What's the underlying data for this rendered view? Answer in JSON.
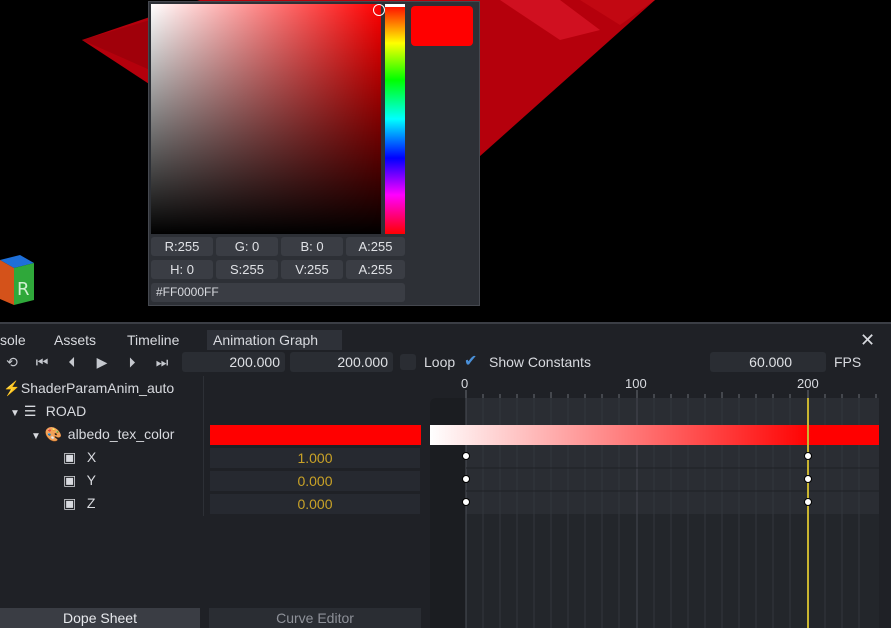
{
  "picker": {
    "color_hex": "#FF0000FF",
    "swatch_color": "#ff0000",
    "rgba": {
      "r": "R:255",
      "g": "G:  0",
      "b": "B:  0",
      "a": "A:255"
    },
    "hsva": {
      "h": "H:  0",
      "s": "S:255",
      "v": "V:255",
      "a": "A:255"
    }
  },
  "tabs": [
    {
      "label": "sole"
    },
    {
      "label": "Assets"
    },
    {
      "label": "Timeline"
    },
    {
      "label": "Animation Graph"
    }
  ],
  "toolbar": {
    "icons": [
      "reset-icon",
      "skip-start-icon",
      "prev-frame-icon",
      "play-icon",
      "next-frame-icon",
      "skip-end-icon"
    ],
    "start_value": "200.000",
    "end_value": "200.000",
    "loop_label": "Loop",
    "show_constants_label": "Show Constants",
    "fps_value": "60.000",
    "fps_label": "FPS"
  },
  "tree": {
    "animation": "ShaderParamAnim_auto",
    "node": "ROAD",
    "param": "albedo_tex_color",
    "channels": [
      {
        "name": "X",
        "value": "1.000"
      },
      {
        "name": "Y",
        "value": "0.000"
      },
      {
        "name": "Z",
        "value": "0.000"
      }
    ]
  },
  "ruler": {
    "ticks": [
      "0",
      "100",
      "200"
    ]
  },
  "bottom_tabs": {
    "dope_sheet": "Dope Sheet",
    "curve_editor": "Curve Editor"
  },
  "colors": {
    "accent": "#4a90d9",
    "playhead": "#c9b530",
    "value_text": "#c9a227"
  }
}
